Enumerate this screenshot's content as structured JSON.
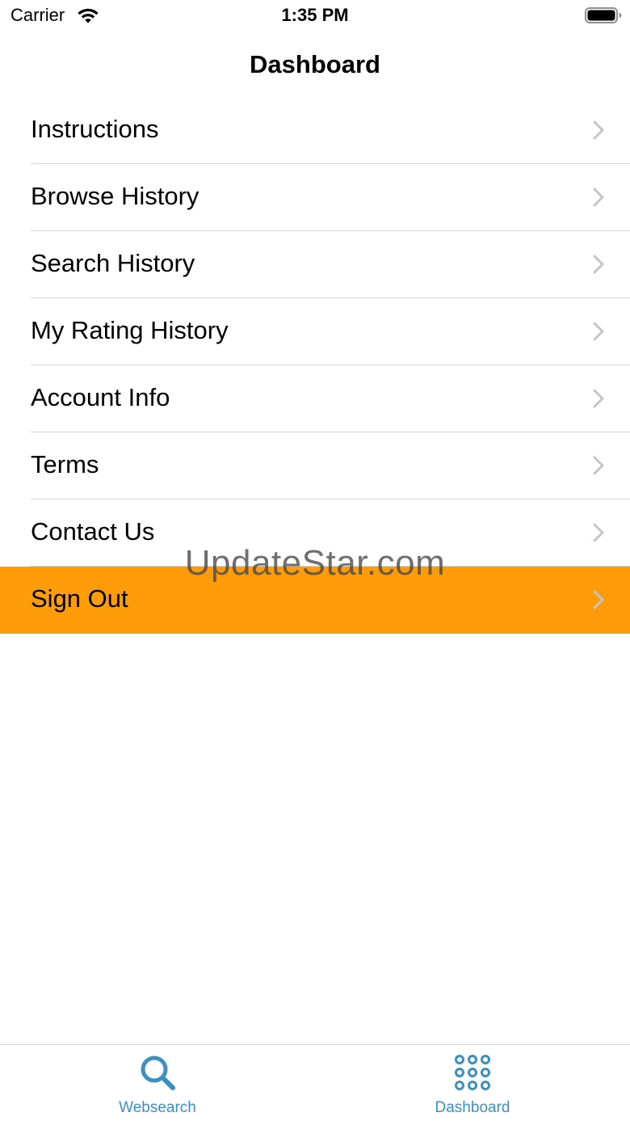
{
  "status_bar": {
    "carrier": "Carrier",
    "time": "1:35 PM"
  },
  "nav": {
    "title": "Dashboard"
  },
  "menu": {
    "items": [
      {
        "label": "Instructions"
      },
      {
        "label": "Browse History"
      },
      {
        "label": "Search History"
      },
      {
        "label": "My Rating History"
      },
      {
        "label": "Account Info"
      },
      {
        "label": "Terms"
      },
      {
        "label": "Contact Us"
      },
      {
        "label": "Sign Out",
        "highlighted": true
      }
    ]
  },
  "watermark": "UpdateStar.com",
  "tab_bar": {
    "tabs": [
      {
        "label": "Websearch",
        "icon": "search-icon"
      },
      {
        "label": "Dashboard",
        "icon": "grid-dots-icon",
        "selected": true
      }
    ]
  },
  "colors": {
    "highlight": "#fe9c0a",
    "tab_tint": "#3d8fbd",
    "separator": "#d6d6d9",
    "chevron": "#c4c4c7"
  }
}
